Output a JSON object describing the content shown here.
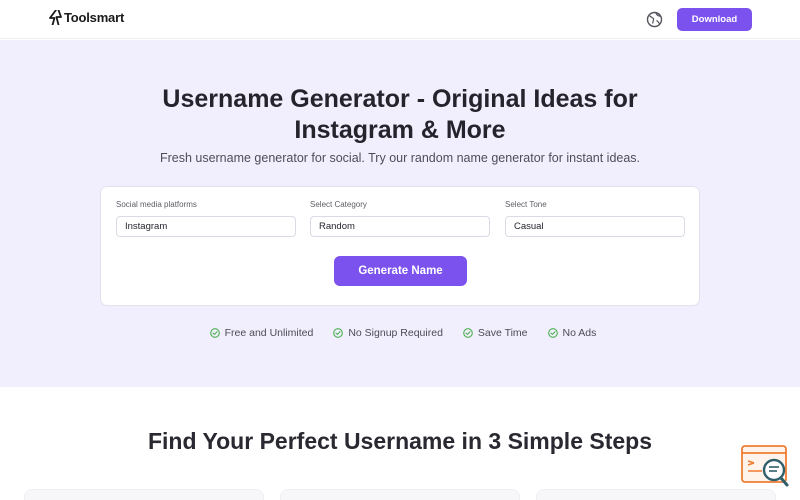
{
  "header": {
    "logo_text": "Toolsmart",
    "download_label": "Download"
  },
  "hero": {
    "title": "Username Generator - Original Ideas for Instagram & More",
    "subtitle": "Fresh username generator for social. Try our random name generator for instant ideas."
  },
  "form": {
    "fields": [
      {
        "label": "Social media platforms",
        "value": "Instagram"
      },
      {
        "label": "Select Category",
        "value": "Random"
      },
      {
        "label": "Select Tone",
        "value": "Casual"
      }
    ],
    "generate_label": "Generate Name"
  },
  "features": [
    {
      "label": "Free and Unlimited"
    },
    {
      "label": "No Signup Required"
    },
    {
      "label": "Save Time"
    },
    {
      "label": "No Ads"
    }
  ],
  "steps": {
    "title": "Find Your Perfect Username in 3 Simple Steps"
  },
  "colors": {
    "accent": "#7c52ee",
    "hero_background": "#f1effd",
    "check": "#4caf50",
    "widget": "#f07d32"
  },
  "icons": {
    "logo": "lightning-logo-icon",
    "language": "globe-icon",
    "feature": "check-circle-icon",
    "widget": "chat-search-icon"
  }
}
